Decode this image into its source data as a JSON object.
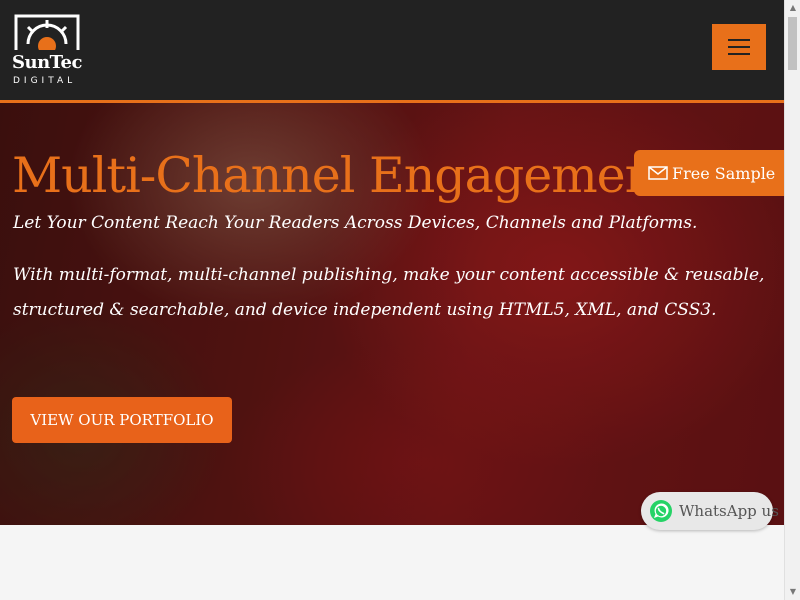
{
  "header": {
    "logo": {
      "name": "SunTec",
      "sub": "DIGITAL"
    },
    "menu_icon": "hamburger-icon"
  },
  "hero": {
    "title": "Multi-Channel Engagement.",
    "subtitle": "Let Your Content Reach Your Readers Across Devices, Channels and Platforms.",
    "body": "With multi-format, multi-channel publishing, make your content accessible & reusable, structured & searchable, and device independent using HTML5, XML, and CSS3.",
    "cta_label": "VIEW OUR PORTFOLIO"
  },
  "floating": {
    "free_sample_label": "Free Sample",
    "free_sample_icon": "envelope-icon",
    "whatsapp_label": "WhatsApp us",
    "whatsapp_icon": "whatsapp-icon"
  },
  "colors": {
    "accent": "#e8701a",
    "header_bg": "#222222",
    "hero_text": "#ffffff"
  }
}
